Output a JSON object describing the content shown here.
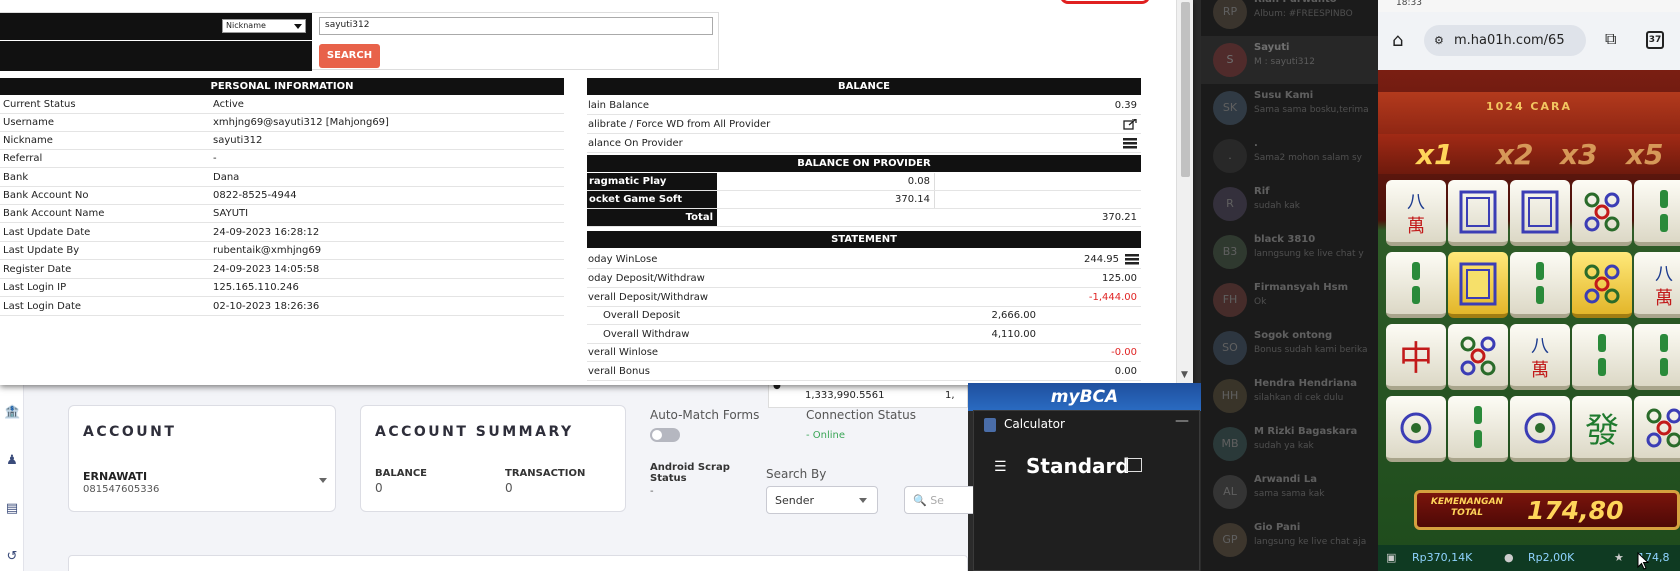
{
  "popup": {
    "search": {
      "filter_value": "Nickname",
      "query": "sayuti312",
      "button": "SEARCH"
    },
    "personal": {
      "title": "PERSONAL INFORMATION",
      "rows": [
        {
          "k": "Current Status",
          "v": "Active"
        },
        {
          "k": "Username",
          "v": "xmhjng69@sayuti312  [Mahjong69]"
        },
        {
          "k": "Nickname",
          "v": "sayuti312"
        },
        {
          "k": "Referral",
          "v": "-"
        },
        {
          "k": "Bank",
          "v": "Dana"
        },
        {
          "k": "Bank Account No",
          "v": "0822-8525-4944"
        },
        {
          "k": "Bank Account Name",
          "v": "SAYUTI"
        },
        {
          "k": "Last Update Date",
          "v": "24-09-2023 16:28:12"
        },
        {
          "k": "Last Update By",
          "v": "rubentaik@xmhjng69"
        },
        {
          "k": "Register Date",
          "v": "24-09-2023 14:05:58"
        },
        {
          "k": "Last Login IP",
          "v": "125.165.110.246"
        },
        {
          "k": "Last Login Date",
          "v": "02-10-2023 18:26:36"
        }
      ]
    },
    "balance": {
      "title": "BALANCE",
      "main_label": "lain Balance",
      "main_value": "0.39",
      "calibrate_label": "alibrate / Force WD from All Provider",
      "on_provider_label": "alance On Provider",
      "provider_title": "BALANCE ON PROVIDER",
      "providers": [
        {
          "name": "ragmatic Play",
          "amount": "0.08"
        },
        {
          "name": "ocket Game Soft",
          "amount": "370.14"
        }
      ],
      "total_label": "Total",
      "total_value": "370.21",
      "statement_title": "STATEMENT",
      "statement": {
        "today_winlose_label": "oday WinLose",
        "today_winlose_value": "244.95",
        "today_dw_label": "oday Deposit/Withdraw",
        "today_dw_value": "125.00",
        "overall_dw_label": "verall Deposit/Withdraw",
        "overall_dw_value": "-1,444.00",
        "overall_deposit_label": "Overall Deposit",
        "overall_deposit_value": "2,666.00",
        "overall_withdraw_label": "Overall Withdraw",
        "overall_withdraw_value": "4,110.00",
        "overall_winlose_label": "verall Winlose",
        "overall_winlose_value": "-0.00",
        "overall_bonus_label": "verall Bonus",
        "overall_bonus_value": "0.00"
      }
    }
  },
  "dashboard": {
    "balance_widget_value": "1,333,990.5561",
    "balance_widget_cut": "1,",
    "account": {
      "title": "ACCOUNT",
      "name": "ERNAWATI",
      "number": "081547605336"
    },
    "summary": {
      "title": "ACCOUNT SUMMARY",
      "balance_label": "BALANCE",
      "balance_value": "0",
      "transaction_label": "TRANSACTION",
      "transaction_value": "0"
    },
    "auto_match_label": "Auto-Match Forms",
    "connection_label": "Connection Status",
    "connection_value": "- Online",
    "android_label": "Android Scrap Status",
    "android_value": "-",
    "search_by_label": "Search By",
    "search_by_value": "Sender",
    "search_placeholder": "Se"
  },
  "bca": {
    "label": "myBCA"
  },
  "calculator": {
    "title": "Calculator",
    "mode": "Standard",
    "minimize": "—"
  },
  "chat": [
    {
      "initials": "RP",
      "name": "Rian Purwanto",
      "msg": "Album: #FREESPINBO"
    },
    {
      "initials": "S",
      "name": "Sayuti",
      "msg": "M : sayuti312"
    },
    {
      "initials": "SK",
      "name": "Susu Kami",
      "msg": "Sama sama bosku,terima"
    },
    {
      "initials": ".",
      "name": ".",
      "msg": "Sama2 mohon salam sy"
    },
    {
      "initials": "R",
      "name": "Rif",
      "msg": "sudah kak"
    },
    {
      "initials": "B3",
      "name": "black 3810",
      "msg": "lanngsung ke live chat y"
    },
    {
      "initials": "FH",
      "name": "Firmansyah Hsm",
      "msg": "Ok"
    },
    {
      "initials": "SO",
      "name": "Sogok ontong",
      "msg": "Bonus sudah kami berika"
    },
    {
      "initials": "HH",
      "name": "Hendra Hendriana",
      "msg": "silahkan di cek dulu"
    },
    {
      "initials": "MB",
      "name": "M Rizki Bagaskara",
      "msg": "sudah ya kak"
    },
    {
      "initials": "AL",
      "name": "Arwandi La",
      "msg": "sama sama kak"
    },
    {
      "initials": "GP",
      "name": "Gio Pani",
      "msg": "langsung ke live chat aja"
    }
  ],
  "phone": {
    "time": "18:33",
    "url": "m.ha01h.com/65",
    "tab_count": "37",
    "banner": "1024 CARA",
    "multipliers": [
      "x1",
      "x2",
      "x3",
      "x5"
    ],
    "win_label": "KEMENANGAN TOTAL",
    "win_amount": "174,80",
    "footer_balance": "Rp370,14K",
    "footer_bet": "Rp2,00K",
    "footer_win": "174,8"
  },
  "colors": {
    "search_button": "#e8624a",
    "negative": "#e02424",
    "online": "#3aa657",
    "bca": "#1f4f9e"
  }
}
